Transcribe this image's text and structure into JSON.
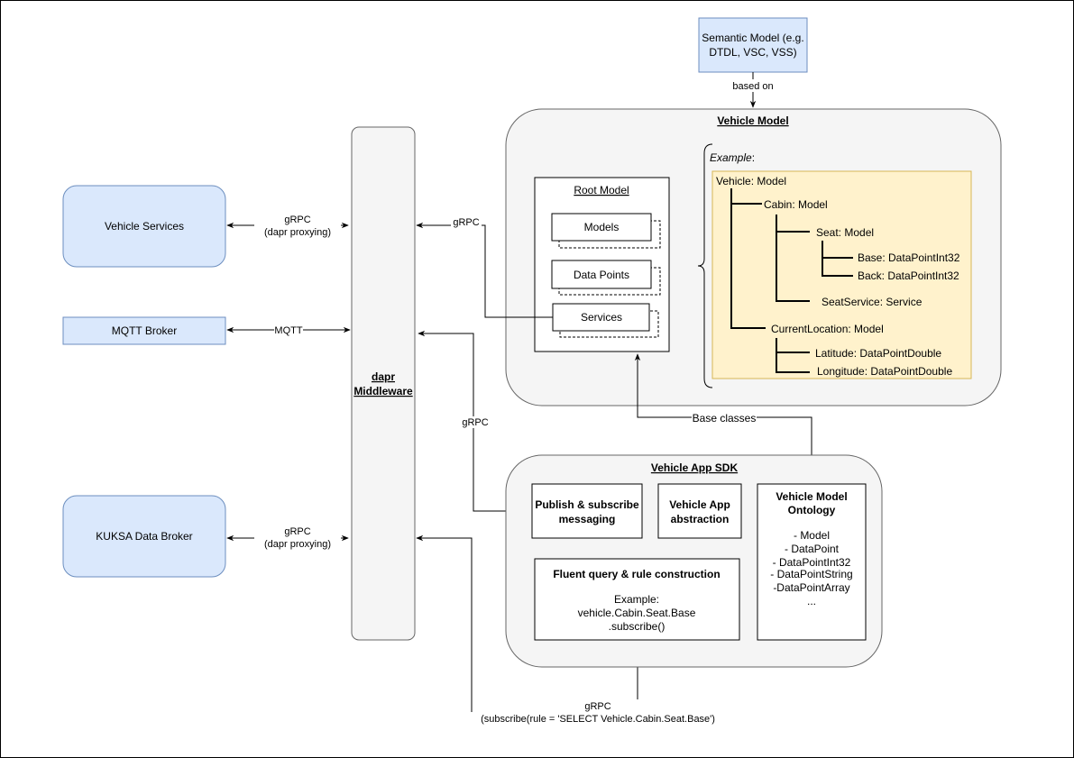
{
  "colors": {
    "blue_fill": "#dae8fc",
    "blue_stroke": "#6c8ebf",
    "gray_fill": "#f5f5f5",
    "gray_stroke": "#666666",
    "yellow_fill": "#fff2cc",
    "yellow_stroke": "#d6b656"
  },
  "semantic_model": {
    "line1": "Semantic Model (e.g.",
    "line2": "DTDL, VSC, VSS)",
    "edge_label": "based on"
  },
  "vehicle_model": {
    "title": "Vehicle Model",
    "root_model": {
      "title": "Root Model",
      "items": [
        "Models",
        "Data Points",
        "Services"
      ]
    },
    "example_label": "Example",
    "example_colon": ":",
    "tree": {
      "vehicle": "Vehicle: Model",
      "cabin": "Cabin: Model",
      "seat": "Seat: Model",
      "base": "Base: DataPointInt32",
      "back": "Back: DataPointInt32",
      "seat_service": "SeatService: Service",
      "current_location": "CurrentLocation: Model",
      "latitude": "Latitude: DataPointDouble",
      "longitude": "Longitude: DataPointDouble"
    }
  },
  "middleware": {
    "line1": "dapr",
    "line2": "Middleware"
  },
  "left_nodes": {
    "vehicle_services": "Vehicle Services",
    "mqtt_broker": "MQTT Broker",
    "kuksa": "KUKSA Data Broker"
  },
  "edges": {
    "vs_grpc": "gRPC",
    "vs_proxy": "(dapr proxying)",
    "mqtt": "MQTT",
    "kuksa_grpc": "gRPC",
    "kuksa_proxy": "(dapr proxying)",
    "services_grpc": "gRPC",
    "pubsub_grpc": "gRPC",
    "base_classes": "Base classes",
    "subscribe_grpc": "gRPC",
    "subscribe_rule": "(subscribe(rule = 'SELECT Vehicle.Cabin.Seat.Base')"
  },
  "sdk": {
    "title": "Vehicle App SDK",
    "pubsub": {
      "line1": "Publish & subscribe",
      "line2": "messaging"
    },
    "app_abstraction": {
      "line1": "Vehicle App",
      "line2": "abstraction"
    },
    "ontology": {
      "line1": "Vehicle Model",
      "line2": "Ontology",
      "items": [
        "- Model",
        "- DataPoint",
        "- DataPointInt32",
        "- DataPointString",
        "-DataPointArray",
        "..."
      ]
    },
    "fluent": {
      "title": "Fluent query & rule construction",
      "line1": "Example:",
      "line2": "vehicle.Cabin.Seat.Base",
      "line3": ".subscribe()"
    }
  }
}
